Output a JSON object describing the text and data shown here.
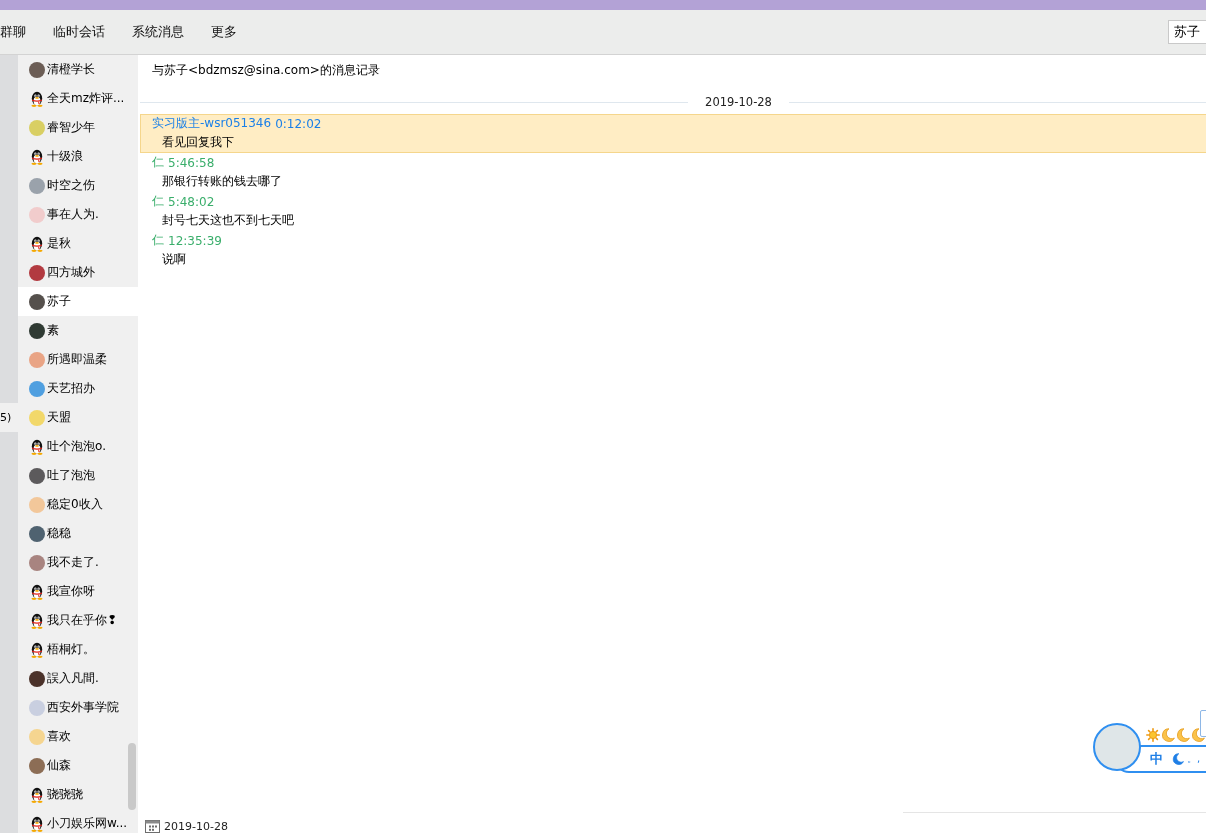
{
  "toolbar": {
    "tabs": [
      {
        "label": "群聊",
        "selected": false
      },
      {
        "label": "临时会话",
        "selected": false
      },
      {
        "label": "系统消息",
        "selected": false
      },
      {
        "label": "更多",
        "selected": false
      }
    ],
    "search": {
      "value": "苏子"
    }
  },
  "side_strip": {
    "label": "5)"
  },
  "contacts": [
    {
      "name": "清橙学长",
      "kind": "photo",
      "selected": false
    },
    {
      "name": "全天mz炸评...",
      "kind": "penguin",
      "selected": false
    },
    {
      "name": "睿智少年",
      "kind": "photo",
      "selected": false
    },
    {
      "name": "十级浪",
      "kind": "penguin",
      "selected": false
    },
    {
      "name": "时空之伤",
      "kind": "photo",
      "selected": false
    },
    {
      "name": "事在人为.",
      "kind": "photo",
      "selected": false
    },
    {
      "name": "是秋",
      "kind": "penguin",
      "selected": false
    },
    {
      "name": "四方城外",
      "kind": "photo",
      "selected": false
    },
    {
      "name": "苏子",
      "kind": "photo",
      "selected": true
    },
    {
      "name": "素",
      "kind": "photo",
      "selected": false
    },
    {
      "name": "所遇即温柔",
      "kind": "photo",
      "selected": false
    },
    {
      "name": "天艺招办",
      "kind": "photo",
      "selected": false
    },
    {
      "name": "天盟",
      "kind": "photo",
      "selected": false
    },
    {
      "name": "吐个泡泡o.",
      "kind": "penguin",
      "selected": false
    },
    {
      "name": "吐了泡泡",
      "kind": "photo",
      "selected": false
    },
    {
      "name": "稳定0收入",
      "kind": "photo",
      "selected": false
    },
    {
      "name": "稳稳",
      "kind": "photo",
      "selected": false
    },
    {
      "name": "我不走了.",
      "kind": "photo",
      "selected": false
    },
    {
      "name": "我宣你呀",
      "kind": "penguin",
      "selected": false
    },
    {
      "name": "我只在乎你❢",
      "kind": "penguin",
      "selected": false
    },
    {
      "name": "梧桐灯。",
      "kind": "penguin",
      "selected": false
    },
    {
      "name": "誤入凡間.",
      "kind": "photo",
      "selected": false
    },
    {
      "name": "西安外事学院",
      "kind": "photo",
      "selected": false
    },
    {
      "name": "喜欢",
      "kind": "photo",
      "selected": false
    },
    {
      "name": "仙森",
      "kind": "photo",
      "selected": false
    },
    {
      "name": "骁骁骁",
      "kind": "penguin",
      "selected": false
    },
    {
      "name": "小刀娱乐网w...",
      "kind": "penguin",
      "selected": false
    }
  ],
  "history": {
    "title": "与苏子<bdzmsz@sina.com>的消息记录",
    "date_divider": "2019-10-28",
    "messages": [
      {
        "sender": "实习版主-wsr051346",
        "time": "0:12:02",
        "text": "看见回复我下",
        "kind": "received",
        "selected": true
      },
      {
        "sender": "仁",
        "time": "5:46:58",
        "text": "那银行转账的钱去哪了",
        "kind": "sent",
        "selected": false
      },
      {
        "sender": "仁",
        "time": "5:48:02",
        "text": "封号七天这也不到七天吧",
        "kind": "sent",
        "selected": false
      },
      {
        "sender": "仁",
        "time": "12:35:39",
        "text": "说啊",
        "kind": "sent",
        "selected": false
      }
    ]
  },
  "footer": {
    "date": "2019-10-28"
  },
  "ime": {
    "mode": "中",
    "punctuation": "。,"
  }
}
